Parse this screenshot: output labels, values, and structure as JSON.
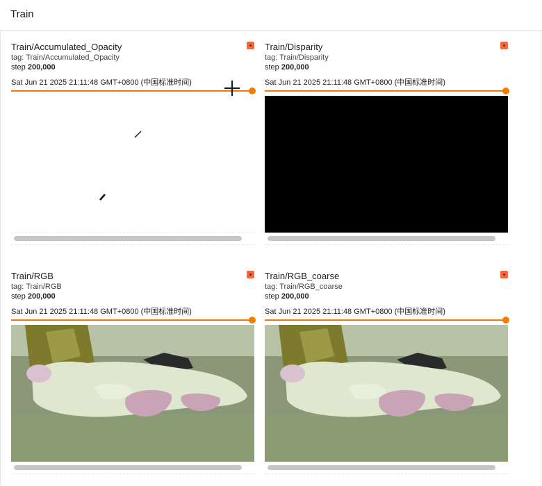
{
  "section": {
    "title": "Train"
  },
  "cards": [
    {
      "title": "Train/Accumulated_Opacity",
      "tag_label": "tag:",
      "tag": "Train/Accumulated_Opacity",
      "step_label": "step",
      "step": "200,000",
      "date": "Sat Jun 21 2025 21:11:48 GMT+0800 (中国标准时间)",
      "image_kind": "blank",
      "slider_position": 1.0
    },
    {
      "title": "Train/Disparity",
      "tag_label": "tag:",
      "tag": "Train/Disparity",
      "step_label": "step",
      "step": "200,000",
      "date": "Sat Jun 21 2025 21:11:48 GMT+0800 (中国标准时间)",
      "image_kind": "black",
      "slider_position": 1.0
    },
    {
      "title": "Train/RGB",
      "tag_label": "tag:",
      "tag": "Train/RGB",
      "step_label": "step",
      "step": "200,000",
      "date": "Sat Jun 21 2025 21:11:48 GMT+0800 (中国标准时间)",
      "image_kind": "photo",
      "slider_position": 1.0
    },
    {
      "title": "Train/RGB_coarse",
      "tag_label": "tag:",
      "tag": "Train/RGB_coarse",
      "step_label": "step",
      "step": "200,000",
      "date": "Sat Jun 21 2025 21:11:48 GMT+0800 (中国标准时间)",
      "image_kind": "photo",
      "slider_position": 1.0
    }
  ],
  "colors": {
    "accent": "#f57c00",
    "pin": "#f4683c",
    "scrollbar": "#c6c6c6",
    "plush": "#dfe8cf",
    "plush_feet": "#c9a3b6",
    "background_plant": "#7d7a2e"
  },
  "icons": {
    "pin": "pin-icon",
    "cursor": "crosshair-cursor-icon"
  }
}
